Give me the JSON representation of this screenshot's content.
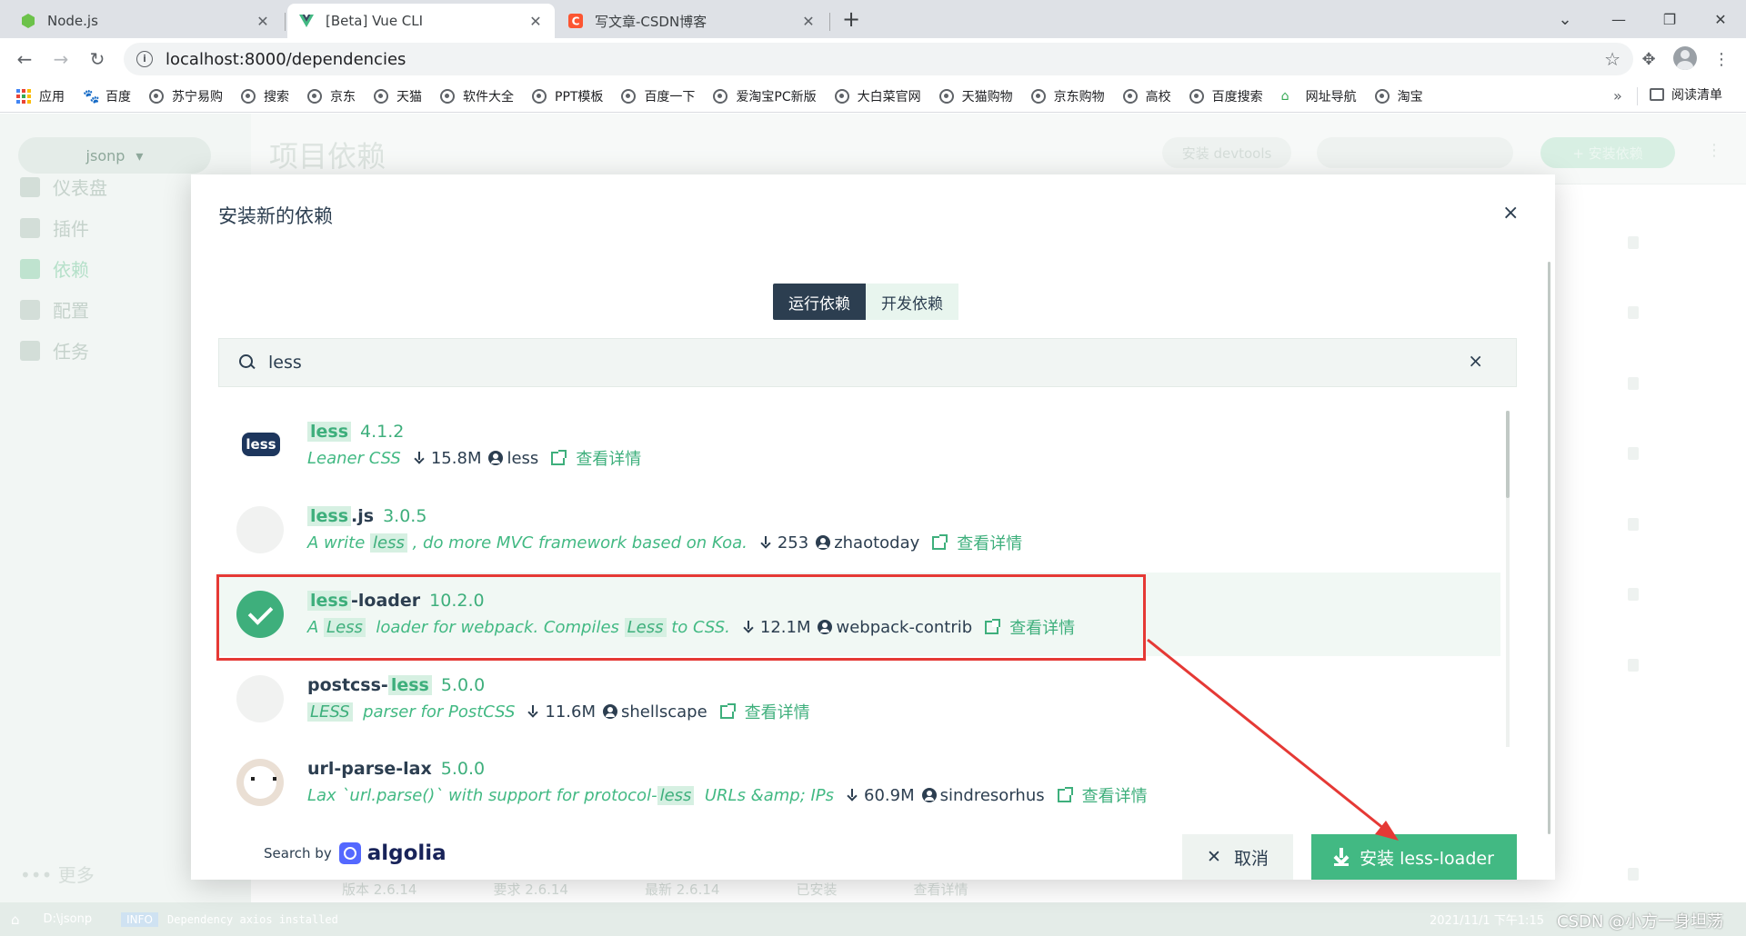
{
  "browser": {
    "tabs": [
      {
        "title": "Node.js",
        "favicon": "nodejs-icon",
        "active": false
      },
      {
        "title": "[Beta] Vue CLI",
        "favicon": "vue-icon",
        "active": true
      },
      {
        "title": "写文章-CSDN博客",
        "favicon": "csdn-icon",
        "active": false
      }
    ],
    "tab_close": "✕",
    "new_tab": "+",
    "window_controls": {
      "minimize": "—",
      "maximize": "❐",
      "close": "✕"
    },
    "nav": {
      "back": "←",
      "forward": "→",
      "reload": "↻"
    },
    "url": "localhost:8000/dependencies",
    "url_info": "i",
    "star": "☆",
    "extensions": "✥",
    "menu": "⋮",
    "bookmarks": [
      {
        "label": "应用",
        "icon": "apps-icon"
      },
      {
        "label": "百度",
        "icon": "baidu-paw-icon"
      },
      {
        "label": "苏宁易购",
        "icon": "globe-icon"
      },
      {
        "label": "搜索",
        "icon": "globe-icon"
      },
      {
        "label": "京东",
        "icon": "globe-icon"
      },
      {
        "label": "天猫",
        "icon": "globe-icon"
      },
      {
        "label": "软件大全",
        "icon": "globe-icon"
      },
      {
        "label": "PPT模板",
        "icon": "globe-icon"
      },
      {
        "label": "百度一下",
        "icon": "globe-icon"
      },
      {
        "label": "爱淘宝PC新版",
        "icon": "globe-icon"
      },
      {
        "label": "大白菜官网",
        "icon": "globe-icon"
      },
      {
        "label": "天猫购物",
        "icon": "globe-icon"
      },
      {
        "label": "京东购物",
        "icon": "globe-icon"
      },
      {
        "label": "高校",
        "icon": "globe-icon"
      },
      {
        "label": "百度搜索",
        "icon": "globe-icon"
      },
      {
        "label": "网址导航",
        "icon": "site-nav-icon"
      },
      {
        "label": "淘宝",
        "icon": "globe-icon"
      }
    ],
    "bookmarks_more": "»",
    "reading_list": "阅读清单"
  },
  "app": {
    "project": "jsonp",
    "project_caret": "▾",
    "sidebar": [
      {
        "label": "仪表盘"
      },
      {
        "label": "插件"
      },
      {
        "label": "依赖"
      },
      {
        "label": "配置"
      },
      {
        "label": "任务"
      }
    ],
    "more": "更多",
    "page_title": "项目依赖",
    "install_devtools": "安装 devtools",
    "install_dep": "+ 安装依赖",
    "header_menu": "⋮",
    "bg_row": [
      "版本 2.6.14",
      "要求 2.6.14",
      "最新 2.6.14",
      "已安装",
      "查看详情"
    ],
    "statusbar": {
      "home": "⌂",
      "folder": "D:\\jsonp",
      "info_tag": "INFO",
      "message": "Dependency axios installed",
      "time": "2021/11/1  下午1:15"
    }
  },
  "modal": {
    "title": "安装新的依赖",
    "close": "×",
    "tabs": [
      "运行依赖",
      "开发依赖"
    ],
    "active_tab": 0,
    "search_value": "less",
    "search_clear": "×",
    "view_details": "查看详情",
    "packages": [
      {
        "name": [
          {
            "t": "less",
            "h": true
          }
        ],
        "version": "4.1.2",
        "desc": [
          {
            "t": "Leaner CSS",
            "h": false
          }
        ],
        "downloads": "15.8M",
        "author": "less",
        "logo": "less-logo",
        "selected": false
      },
      {
        "name": [
          {
            "t": "less",
            "h": true
          },
          {
            "t": ".js",
            "h": false
          }
        ],
        "version": "3.0.5",
        "desc": [
          {
            "t": "A write ",
            "h": false
          },
          {
            "t": "less",
            "h": true
          },
          {
            "t": " , do more MVC framework based on Koa.",
            "h": false
          }
        ],
        "downloads": "253",
        "author": "zhaotoday",
        "logo": "placeholder-logo",
        "selected": false
      },
      {
        "name": [
          {
            "t": "less",
            "h": true
          },
          {
            "t": "-loader",
            "h": false
          }
        ],
        "version": "10.2.0",
        "desc": [
          {
            "t": "A ",
            "h": false
          },
          {
            "t": "Less",
            "h": true
          },
          {
            "t": "  loader for webpack. Compiles ",
            "h": false
          },
          {
            "t": "Less",
            "h": true
          },
          {
            "t": " to CSS.",
            "h": false
          }
        ],
        "downloads": "12.1M",
        "author": "webpack-contrib",
        "logo": "check-icon",
        "selected": true
      },
      {
        "name": [
          {
            "t": "postcss-",
            "h": false
          },
          {
            "t": "less",
            "h": true
          }
        ],
        "version": "5.0.0",
        "desc": [
          {
            "t": "LESS",
            "h": true
          },
          {
            "t": "  parser for PostCSS",
            "h": false
          }
        ],
        "downloads": "11.6M",
        "author": "shellscape",
        "logo": "placeholder-logo",
        "selected": false
      },
      {
        "name": [
          {
            "t": "url-parse-lax",
            "h": false
          }
        ],
        "version": "5.0.0",
        "desc": [
          {
            "t": "Lax `url.parse()` with support for protocol-",
            "h": false
          },
          {
            "t": "less",
            "h": true
          },
          {
            "t": "  URLs &amp; IPs",
            "h": false
          }
        ],
        "downloads": "60.9M",
        "author": "sindresorhus",
        "logo": "avatar-dog",
        "selected": false
      }
    ],
    "search_by": "Search by",
    "algolia": "algolia",
    "cancel": "取消",
    "cancel_icon": "✕",
    "install": "安装 less-loader"
  },
  "colors": {
    "accent": "#42b983",
    "text_dark": "#2c3e50",
    "highlight_bg": "#d6f0e2",
    "annotation_red": "#e53935"
  },
  "watermark": "CSDN @小方一身坦荡"
}
